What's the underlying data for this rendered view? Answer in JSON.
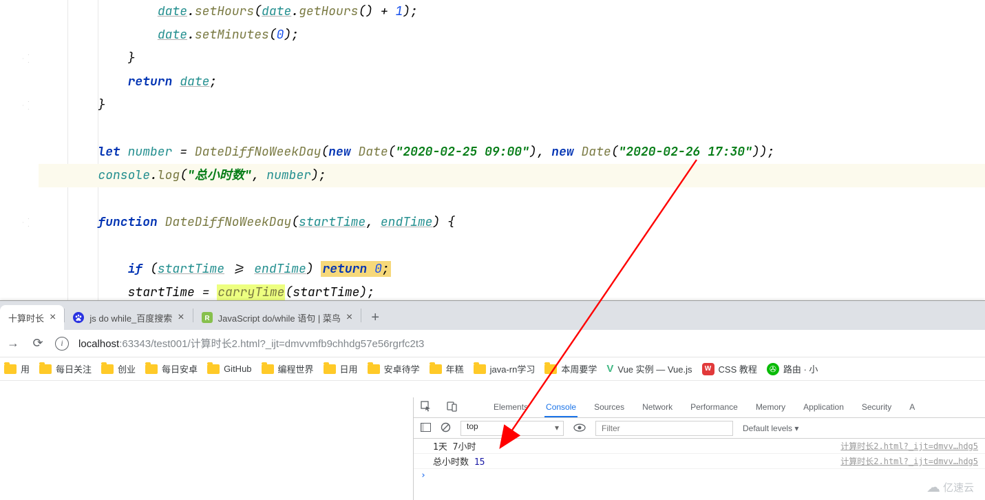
{
  "editor": {
    "lines": [
      {
        "indent": 4,
        "tokens": [
          [
            "ident-u",
            "date"
          ],
          [
            "punct",
            "."
          ],
          [
            "func",
            "setHours"
          ],
          [
            "punct",
            "("
          ],
          [
            "ident-u",
            "date"
          ],
          [
            "punct",
            "."
          ],
          [
            "func",
            "getHours"
          ],
          [
            "punct",
            "() + "
          ],
          [
            "number",
            "1"
          ],
          [
            "punct",
            ");"
          ]
        ]
      },
      {
        "indent": 4,
        "tokens": [
          [
            "ident-u",
            "date"
          ],
          [
            "punct",
            "."
          ],
          [
            "func",
            "setMinutes"
          ],
          [
            "punct",
            "("
          ],
          [
            "number",
            "0"
          ],
          [
            "punct",
            ");"
          ]
        ]
      },
      {
        "indent": 3,
        "tokens": [
          [
            "punct",
            "}"
          ]
        ]
      },
      {
        "indent": 3,
        "tokens": [
          [
            "keyword",
            "return "
          ],
          [
            "ident-u",
            "date"
          ],
          [
            "punct",
            ";"
          ]
        ]
      },
      {
        "indent": 2,
        "tokens": [
          [
            "punct",
            "}"
          ]
        ]
      },
      {
        "indent": 2,
        "tokens": []
      },
      {
        "indent": 2,
        "tokens": [
          [
            "keyword",
            "let "
          ],
          [
            "ident",
            "number"
          ],
          [
            "punct",
            " = "
          ],
          [
            "func",
            "DateDiffNoWeekDay"
          ],
          [
            "punct",
            "("
          ],
          [
            "keyword",
            "new "
          ],
          [
            "func",
            "Date"
          ],
          [
            "punct",
            "("
          ],
          [
            "string",
            "\"2020-02-25 09:00\""
          ],
          [
            "punct",
            "), "
          ],
          [
            "keyword",
            "new "
          ],
          [
            "func",
            "Date"
          ],
          [
            "punct",
            "("
          ],
          [
            "string",
            "\"2020-02-26 17:30\""
          ],
          [
            "punct",
            "));"
          ]
        ]
      },
      {
        "indent": 2,
        "hl": true,
        "tokens": [
          [
            "ident",
            "console"
          ],
          [
            "punct",
            "."
          ],
          [
            "func",
            "log"
          ],
          [
            "punct",
            "("
          ],
          [
            "string",
            "\"总小时数\""
          ],
          [
            "punct",
            ", "
          ],
          [
            "ident",
            "number"
          ],
          [
            "punct",
            ");"
          ]
        ]
      },
      {
        "indent": 2,
        "tokens": []
      },
      {
        "indent": 2,
        "tokens": [
          [
            "keyword",
            "function "
          ],
          [
            "func",
            "DateDiffNoWeekDay"
          ],
          [
            "punct",
            "("
          ],
          [
            "ident-u",
            "startTime"
          ],
          [
            "punct",
            ", "
          ],
          [
            "ident-u",
            "endTime"
          ],
          [
            "punct",
            ") {"
          ]
        ]
      },
      {
        "indent": 3,
        "tokens": []
      },
      {
        "indent": 3,
        "tokens": [
          [
            "keyword",
            "if "
          ],
          [
            "punct",
            "("
          ],
          [
            "ident-u",
            "startTime"
          ],
          [
            "punct",
            " >= "
          ],
          [
            "ident-u",
            "endTime"
          ],
          [
            "punct",
            ") "
          ],
          [
            "hl-ret",
            "return 0;"
          ]
        ]
      },
      {
        "indent": 3,
        "tokens": [
          [
            "punct",
            "startTime = "
          ],
          [
            "hl-call",
            "carryTime"
          ],
          [
            "punct",
            "(startTime);"
          ]
        ]
      }
    ],
    "fold_rows": [
      2,
      4,
      9
    ]
  },
  "browser": {
    "tabs": [
      {
        "title": "十算时长",
        "favtype": "none",
        "active": true
      },
      {
        "title": "js do while_百度搜索",
        "favtype": "baidu"
      },
      {
        "title": "JavaScript do/while 语句 | 菜鸟",
        "favtype": "runoob"
      }
    ],
    "url_host": "localhost",
    "url_rest": ":63343/test001/计算时长2.html?_ijt=dmvvmfb9chhdg57e56rgrfc2t3",
    "bookmarks": [
      {
        "t": "用",
        "icon": "folder"
      },
      {
        "t": "每日关注",
        "icon": "folder"
      },
      {
        "t": "创业",
        "icon": "folder"
      },
      {
        "t": "每日安卓",
        "icon": "folder"
      },
      {
        "t": "GitHub",
        "icon": "folder"
      },
      {
        "t": "编程世界",
        "icon": "folder"
      },
      {
        "t": "日用",
        "icon": "folder"
      },
      {
        "t": "安卓待学",
        "icon": "folder"
      },
      {
        "t": "年糕",
        "icon": "folder"
      },
      {
        "t": "java-rn学习",
        "icon": "folder"
      },
      {
        "t": "本周要学",
        "icon": "folder"
      },
      {
        "t": "Vue 实例 — Vue.js",
        "icon": "vue"
      },
      {
        "t": "CSS 教程",
        "icon": "w3"
      },
      {
        "t": "路由 · 小",
        "icon": "wx"
      }
    ]
  },
  "devtools": {
    "tabs": [
      "Elements",
      "Console",
      "Sources",
      "Network",
      "Performance",
      "Memory",
      "Application",
      "Security",
      "A"
    ],
    "active_tab": "Console",
    "context": "top",
    "filter_placeholder": "Filter",
    "levels": "Default levels ▾",
    "rows": [
      {
        "msg_plain": "1天  7小时",
        "src": "计算时长2.html?_ijt=dmvv…hdg5"
      },
      {
        "msg_prefix": "总小时数  ",
        "msg_num": "15",
        "src": "计算时长2.html?_ijt=dmvv…hdg5"
      }
    ]
  },
  "watermark": "亿速云"
}
